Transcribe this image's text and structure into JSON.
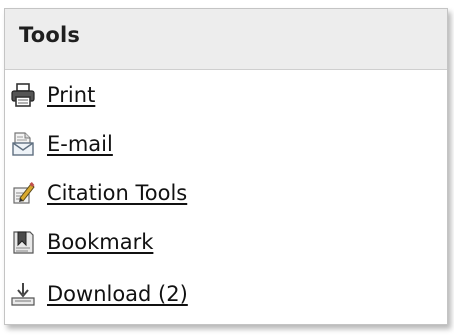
{
  "panel": {
    "title": "Tools"
  },
  "tools": [
    {
      "label": "Print",
      "icon": "printer-icon"
    },
    {
      "label": "E-mail",
      "icon": "email-icon"
    },
    {
      "label": "Citation Tools",
      "icon": "citation-pencil-icon",
      "highlighted": true
    },
    {
      "label": "Bookmark",
      "icon": "bookmark-icon"
    },
    {
      "label": "Download (2)",
      "icon": "download-icon"
    }
  ],
  "colors": {
    "header_background": "#ededed",
    "highlight": "#fbf72c",
    "border": "#c4c4c4"
  }
}
